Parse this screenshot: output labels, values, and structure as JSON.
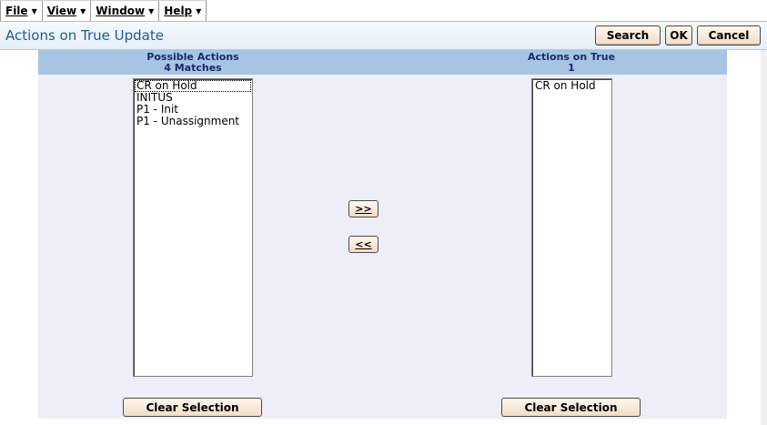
{
  "menu": [
    {
      "label": "File",
      "arrow_icon": "dropdown-arrow-icon"
    },
    {
      "label": "View",
      "arrow_icon": "dropdown-arrow-icon"
    },
    {
      "label": "Window",
      "arrow_icon": "dropdown-arrow-icon"
    },
    {
      "label": "Help",
      "arrow_icon": "dropdown-arrow-icon"
    }
  ],
  "title": "Actions on True Update",
  "toolbar": {
    "search_label": "Search",
    "ok_label": "OK",
    "cancel_label": "Cancel"
  },
  "possible": {
    "heading": "Possible Actions",
    "count_text": "4 Matches",
    "items": [
      "CR on Hold",
      "INITUS",
      "P1 - Init",
      "P1 - Unassignment"
    ],
    "clear_label": "Clear Selection"
  },
  "selected": {
    "heading": "Actions on True",
    "count_text": "1",
    "items": [
      "CR on Hold"
    ],
    "clear_label": "Clear Selection"
  },
  "move": {
    "add_label": ">>",
    "remove_label": "<<"
  },
  "colors": {
    "title_text": "#1f5c8e",
    "panel_header": "#a7c4e2",
    "panel_body": "#eeeef9",
    "button_fill": "#f1dcc8"
  }
}
